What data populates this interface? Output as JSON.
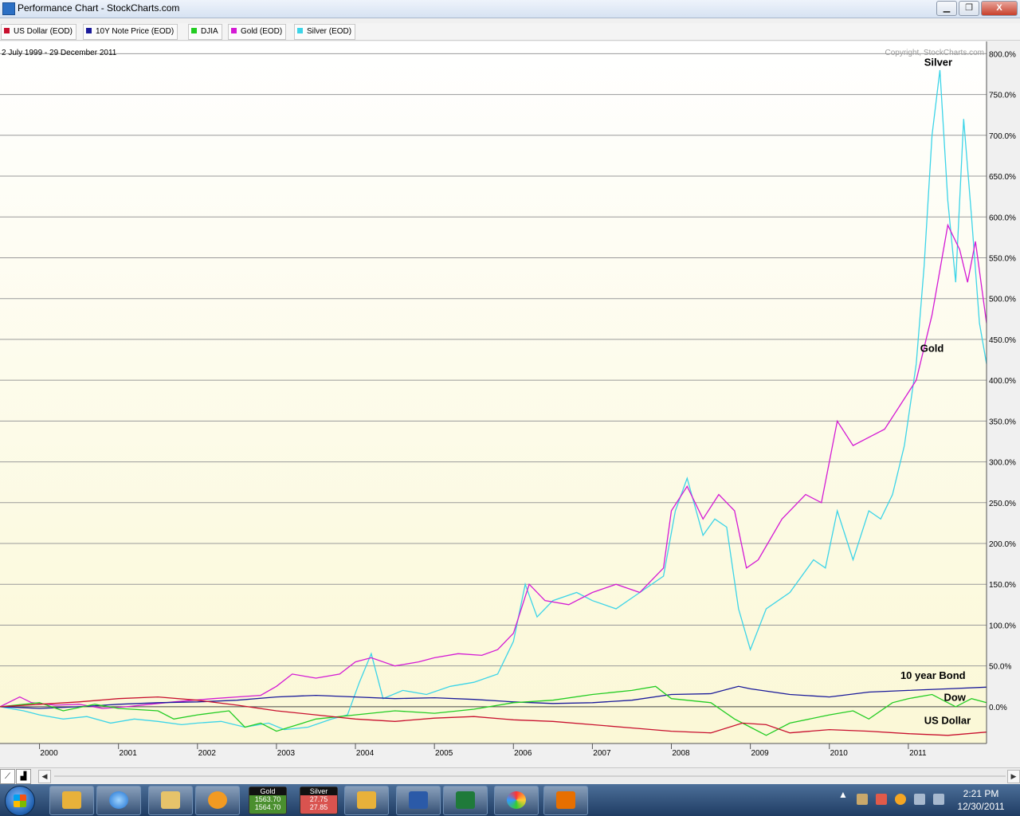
{
  "window": {
    "title": "Performance Chart - StockCharts.com",
    "minimize": "▁",
    "restore": "❐",
    "close": "X"
  },
  "legend": [
    {
      "label": "US Dollar (EOD)",
      "color": "#c8102e"
    },
    {
      "label": "10Y Note Price (EOD)",
      "color": "#1a1a9a"
    },
    {
      "label": "DJIA",
      "color": "#22cc22"
    },
    {
      "label": "Gold (EOD)",
      "color": "#d41ad4"
    },
    {
      "label": "Silver (EOD)",
      "color": "#3cd4e8"
    }
  ],
  "chart_data": {
    "type": "line",
    "date_range": "2 July 1999 - 29 December 2011",
    "copyright": "Copyright, StockCharts.com",
    "ylim": [
      -45,
      815
    ],
    "xlim": [
      1999.5,
      2011.99
    ],
    "yticks": [
      "800.0%",
      "750.0%",
      "700.0%",
      "650.0%",
      "600.0%",
      "550.0%",
      "500.0%",
      "450.0%",
      "400.0%",
      "350.0%",
      "300.0%",
      "250.0%",
      "200.0%",
      "150.0%",
      "100.0%",
      "50.0%",
      "0.0%"
    ],
    "ytick_values": [
      800,
      750,
      700,
      650,
      600,
      550,
      500,
      450,
      400,
      350,
      300,
      250,
      200,
      150,
      100,
      50,
      0
    ],
    "xticks": [
      "2000",
      "2001",
      "2002",
      "2003",
      "2004",
      "2005",
      "2006",
      "2007",
      "2008",
      "2009",
      "2010",
      "2011"
    ],
    "xtick_values": [
      2000,
      2001,
      2002,
      2003,
      2004,
      2005,
      2006,
      2007,
      2008,
      2009,
      2010,
      2011
    ],
    "grid": true,
    "annotations": [
      {
        "text": "Silver",
        "x": 2011.2,
        "y": 785
      },
      {
        "text": "Gold",
        "x": 2011.15,
        "y": 435
      },
      {
        "text": "10 year Bond",
        "x": 2010.9,
        "y": 34
      },
      {
        "text": "Dow",
        "x": 2011.45,
        "y": 7
      },
      {
        "text": "US Dollar",
        "x": 2011.2,
        "y": -21
      }
    ],
    "series": [
      {
        "name": "Silver (EOD)",
        "color": "#3cd4e8",
        "x": [
          1999.5,
          1999.8,
          2000.0,
          2000.3,
          2000.6,
          2000.9,
          2001.2,
          2001.5,
          2001.8,
          2002.0,
          2002.3,
          2002.6,
          2002.9,
          2003.1,
          2003.4,
          2003.7,
          2003.9,
          2004.05,
          2004.2,
          2004.35,
          2004.6,
          2004.9,
          2005.2,
          2005.5,
          2005.8,
          2006.0,
          2006.15,
          2006.3,
          2006.5,
          2006.8,
          2007.0,
          2007.3,
          2007.6,
          2007.9,
          2008.05,
          2008.2,
          2008.4,
          2008.55,
          2008.7,
          2008.85,
          2009.0,
          2009.2,
          2009.5,
          2009.8,
          2009.95,
          2010.1,
          2010.3,
          2010.5,
          2010.65,
          2010.8,
          2010.95,
          2011.1,
          2011.2,
          2011.3,
          2011.4,
          2011.5,
          2011.6,
          2011.7,
          2011.8,
          2011.9,
          2011.99
        ],
        "y": [
          0,
          -5,
          -10,
          -15,
          -12,
          -20,
          -15,
          -18,
          -22,
          -20,
          -18,
          -25,
          -20,
          -28,
          -25,
          -15,
          -10,
          30,
          65,
          10,
          20,
          15,
          25,
          30,
          40,
          80,
          150,
          110,
          130,
          140,
          130,
          120,
          140,
          160,
          240,
          280,
          210,
          230,
          220,
          120,
          70,
          120,
          140,
          180,
          170,
          240,
          180,
          240,
          230,
          260,
          320,
          420,
          540,
          700,
          780,
          620,
          520,
          720,
          600,
          470,
          420
        ]
      },
      {
        "name": "Gold (EOD)",
        "color": "#d41ad4",
        "x": [
          1999.5,
          1999.75,
          1999.9,
          2000.2,
          2000.5,
          2000.8,
          2001.1,
          2001.4,
          2001.7,
          2001.95,
          2002.2,
          2002.5,
          2002.8,
          2003.0,
          2003.2,
          2003.5,
          2003.8,
          2004.0,
          2004.2,
          2004.5,
          2004.8,
          2005.0,
          2005.3,
          2005.6,
          2005.8,
          2006.0,
          2006.2,
          2006.4,
          2006.7,
          2007.0,
          2007.3,
          2007.6,
          2007.9,
          2008.0,
          2008.2,
          2008.4,
          2008.6,
          2008.8,
          2008.95,
          2009.1,
          2009.4,
          2009.7,
          2009.9,
          2010.1,
          2010.3,
          2010.5,
          2010.7,
          2010.9,
          2011.1,
          2011.3,
          2011.5,
          2011.65,
          2011.75,
          2011.85,
          2011.99
        ],
        "y": [
          0,
          12,
          5,
          2,
          3,
          -2,
          0,
          3,
          6,
          8,
          10,
          12,
          14,
          25,
          40,
          35,
          40,
          55,
          60,
          50,
          55,
          60,
          65,
          63,
          70,
          90,
          150,
          130,
          125,
          140,
          150,
          140,
          170,
          240,
          270,
          230,
          260,
          240,
          170,
          180,
          230,
          260,
          250,
          350,
          320,
          330,
          340,
          370,
          400,
          480,
          590,
          560,
          520,
          570,
          470
        ]
      },
      {
        "name": "10Y Note Price (EOD)",
        "color": "#1a1a9a",
        "x": [
          1999.5,
          2000.0,
          2000.5,
          2001.0,
          2001.5,
          2002.0,
          2002.5,
          2003.0,
          2003.5,
          2004.0,
          2004.5,
          2005.0,
          2005.5,
          2006.0,
          2006.5,
          2007.0,
          2007.5,
          2008.0,
          2008.5,
          2008.85,
          2009.0,
          2009.5,
          2010.0,
          2010.5,
          2011.0,
          2011.5,
          2011.99
        ],
        "y": [
          0,
          -2,
          0,
          3,
          5,
          6,
          8,
          12,
          14,
          12,
          10,
          11,
          9,
          6,
          4,
          5,
          8,
          15,
          16,
          25,
          22,
          15,
          12,
          18,
          20,
          22,
          24
        ]
      },
      {
        "name": "DJIA",
        "color": "#22cc22",
        "x": [
          1999.5,
          2000.0,
          2000.3,
          2000.7,
          2001.0,
          2001.5,
          2001.7,
          2002.0,
          2002.4,
          2002.6,
          2002.8,
          2003.0,
          2003.5,
          2004.0,
          2004.5,
          2005.0,
          2005.5,
          2006.0,
          2006.5,
          2007.0,
          2007.5,
          2007.8,
          2008.0,
          2008.5,
          2008.8,
          2009.0,
          2009.2,
          2009.5,
          2010.0,
          2010.3,
          2010.5,
          2010.8,
          2011.0,
          2011.3,
          2011.6,
          2011.8,
          2011.99
        ],
        "y": [
          0,
          5,
          -5,
          3,
          -2,
          -5,
          -15,
          -10,
          -5,
          -25,
          -20,
          -30,
          -15,
          -10,
          -5,
          -8,
          -3,
          5,
          8,
          15,
          20,
          25,
          10,
          5,
          -15,
          -25,
          -35,
          -20,
          -10,
          -5,
          -15,
          5,
          10,
          15,
          0,
          10,
          5
        ]
      },
      {
        "name": "US Dollar (EOD)",
        "color": "#c8102e",
        "x": [
          1999.5,
          2000.0,
          2000.5,
          2001.0,
          2001.5,
          2002.0,
          2002.5,
          2003.0,
          2003.5,
          2004.0,
          2004.5,
          2005.0,
          2005.5,
          2006.0,
          2006.5,
          2007.0,
          2007.5,
          2008.0,
          2008.5,
          2008.9,
          2009.2,
          2009.5,
          2010.0,
          2010.5,
          2011.0,
          2011.5,
          2011.99
        ],
        "y": [
          0,
          3,
          6,
          10,
          12,
          8,
          2,
          -5,
          -10,
          -15,
          -18,
          -14,
          -12,
          -16,
          -18,
          -22,
          -26,
          -30,
          -32,
          -20,
          -22,
          -32,
          -28,
          -30,
          -33,
          -35,
          -31
        ]
      }
    ]
  }
}
